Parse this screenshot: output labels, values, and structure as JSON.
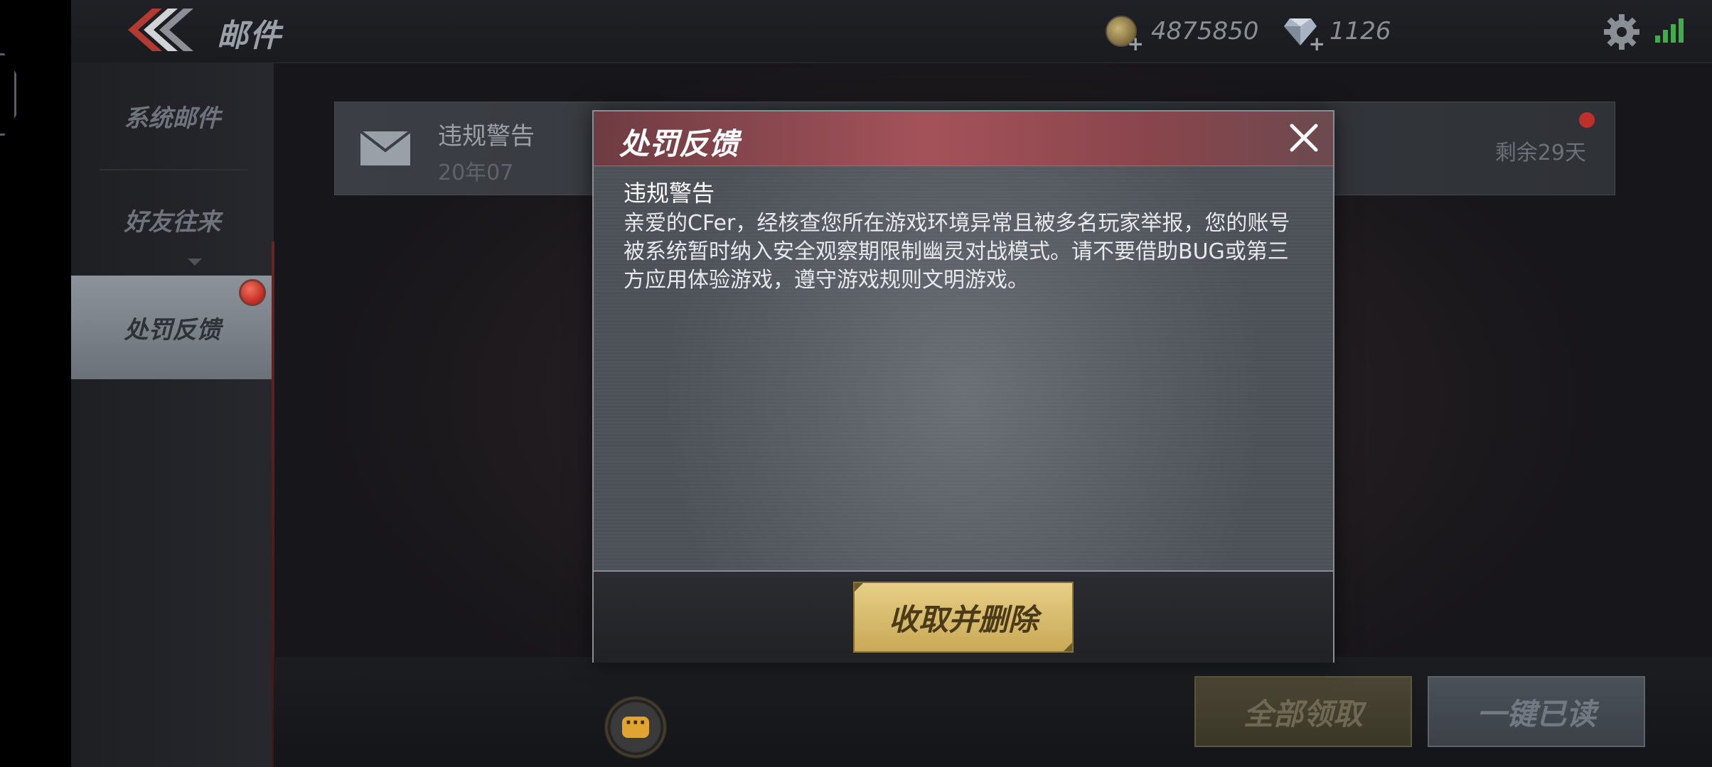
{
  "header": {
    "title": "邮件",
    "gold": "4875850",
    "diamonds": "1126"
  },
  "sidebar": {
    "items": [
      {
        "label": "系统邮件"
      },
      {
        "label": "好友往来"
      },
      {
        "label": "处罚反馈"
      }
    ]
  },
  "mail_list": {
    "items": [
      {
        "title": "违规警告",
        "date": "20年07",
        "remaining": "剩余29天"
      }
    ]
  },
  "modal": {
    "title": "处罚反馈",
    "heading": "违规警告",
    "body": "亲爱的CFer，经核查您所在游戏环境异常且被多名玩家举报，您的账号被系统暂时纳入安全观察期限制幽灵对战模式。请不要借助BUG或第三方应用体验游戏，遵守游戏规则文明游戏。",
    "action_label": "收取并删除"
  },
  "footer": {
    "claim_all_label": "全部领取",
    "read_all_label": "一键已读"
  },
  "colors": {
    "accent_red": "#c0302a",
    "gold_button": "#d8bc6d",
    "modal_header": "#a4525a"
  },
  "icons": [
    "back-chevron-icon",
    "coin-icon",
    "diamond-icon",
    "gear-icon",
    "signal-icon",
    "envelope-icon",
    "close-icon",
    "chat-icon"
  ]
}
